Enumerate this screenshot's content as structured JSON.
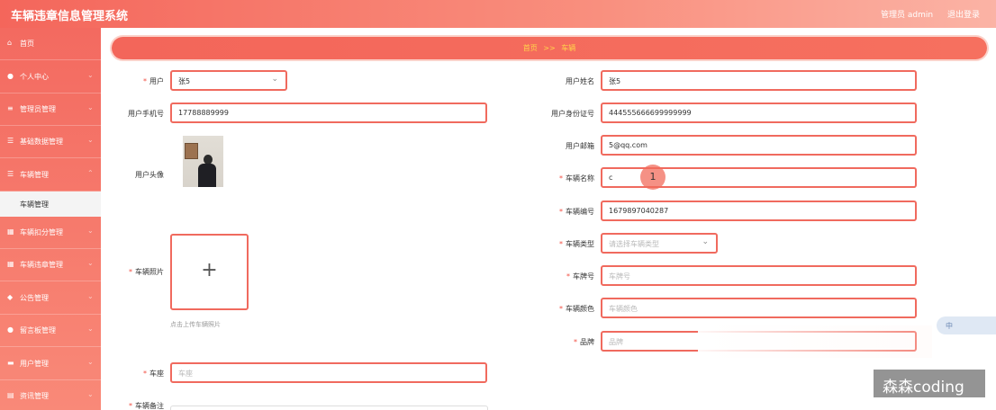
{
  "header": {
    "app_title": "车辆违章信息管理系统",
    "user": "管理员 admin",
    "logout": "退出登录"
  },
  "sidebar": {
    "items": [
      {
        "label": "首页",
        "icon": "home-icon"
      },
      {
        "label": "个人中心",
        "icon": "user-icon"
      },
      {
        "label": "管理员管理",
        "icon": "settings-icon"
      },
      {
        "label": "基础数据管理",
        "icon": "list-icon"
      },
      {
        "label": "车辆管理",
        "icon": "list-icon"
      },
      {
        "label": "车辆扣分管理",
        "icon": "grid-icon"
      },
      {
        "label": "车辆违章管理",
        "icon": "grid-icon"
      },
      {
        "label": "公告管理",
        "icon": "bulb-icon"
      },
      {
        "label": "留言板管理",
        "icon": "user-icon"
      },
      {
        "label": "用户管理",
        "icon": "folder-icon"
      },
      {
        "label": "资讯管理",
        "icon": "doc-icon"
      }
    ],
    "subitem": "车辆管理"
  },
  "breadcrumb": {
    "home": "首页",
    "sep": ">>",
    "current": "车辆"
  },
  "form": {
    "user_label": "用户",
    "user_value": "张5",
    "phone_label": "用户手机号",
    "phone_value": "17788889999",
    "avatar_label": "用户头像",
    "photo_label": "车辆照片",
    "upload_hint": "点击上传车辆照片",
    "seat_label": "车座",
    "seat_placeholder": "车座",
    "remark_label": "车辆备注",
    "name_label": "用户姓名",
    "name_value": "张5",
    "idcard_label": "用户身份证号",
    "idcard_value": "444555666699999999",
    "email_label": "用户邮箱",
    "email_value": "5@qq.com",
    "car_name_label": "车辆名称",
    "car_name_value": "c",
    "car_no_label": "车辆编号",
    "car_no_value": "1679897040287",
    "car_type_label": "车辆类型",
    "car_type_placeholder": "请选择车辆类型",
    "plate_label": "车牌号",
    "plate_placeholder": "车牌号",
    "color_label": "车辆颜色",
    "color_placeholder": "车辆颜色",
    "brand_label": "品牌",
    "brand_placeholder": "品牌"
  },
  "cursor_marker": "1",
  "ime_badge": "中",
  "watermark": "森森coding",
  "colors": {
    "accent": "#f06a5e",
    "crumb_text": "#ffd54a"
  }
}
